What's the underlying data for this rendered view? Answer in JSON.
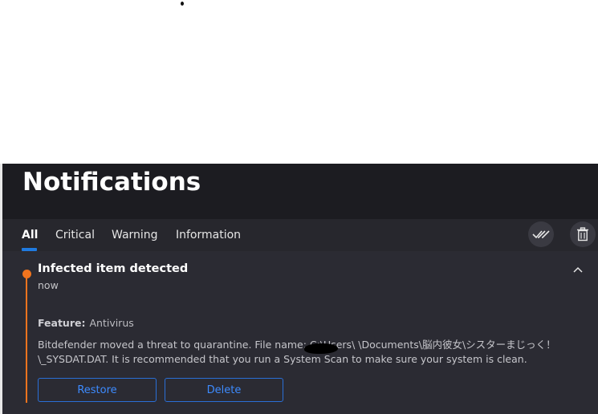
{
  "header": {
    "title": "Notifications"
  },
  "tabs": [
    {
      "label": "All",
      "active": true
    },
    {
      "label": "Critical",
      "active": false
    },
    {
      "label": "Warning",
      "active": false
    },
    {
      "label": "Information",
      "active": false
    }
  ],
  "toolbar": {
    "mark_all_read_icon": "double-check-icon",
    "delete_all_icon": "trash-icon"
  },
  "notification": {
    "title": "Infected item detected",
    "time": "now",
    "feature_label": "Feature:",
    "feature_value": "Antivirus",
    "message_line1": "Bitdefender moved a threat to quarantine. File name: C:\\Users\\        \\Documents\\脳内彼女\\シスターまじっく！",
    "message_line2": "\\_SYSDAT.DAT. It is recommended that you run a System Scan to make sure your system is clean.",
    "restore_label": "Restore",
    "delete_label": "Delete",
    "severity_color": "#f0741e"
  },
  "colors": {
    "accent": "#1f7ae0",
    "button_text": "#3d8bff",
    "background": "#1c1c21",
    "panel": "#2b2b33"
  }
}
